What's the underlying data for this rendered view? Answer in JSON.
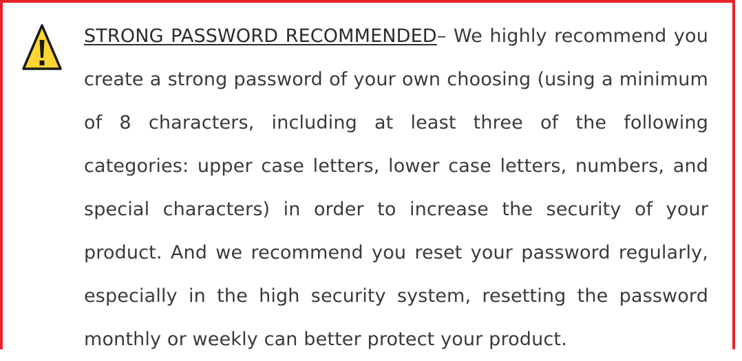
{
  "notice": {
    "heading": "STRONG PASSWORD RECOMMENDED",
    "separator": "– ",
    "body": "We highly recommend you create a strong password of your own choosing (using a minimum of 8 characters, including at least three of the following categories:  upper case letters, lower case letters, numbers, and special characters) in order to increase the security of your product. And we recommend you reset your password regularly, especially in the high security system, resetting the password monthly or weekly can better protect your product.",
    "icon": "warning-icon"
  },
  "colors": {
    "border": "#e8232a",
    "icon_fill": "#ffd633",
    "text": "#3a3a3a"
  }
}
